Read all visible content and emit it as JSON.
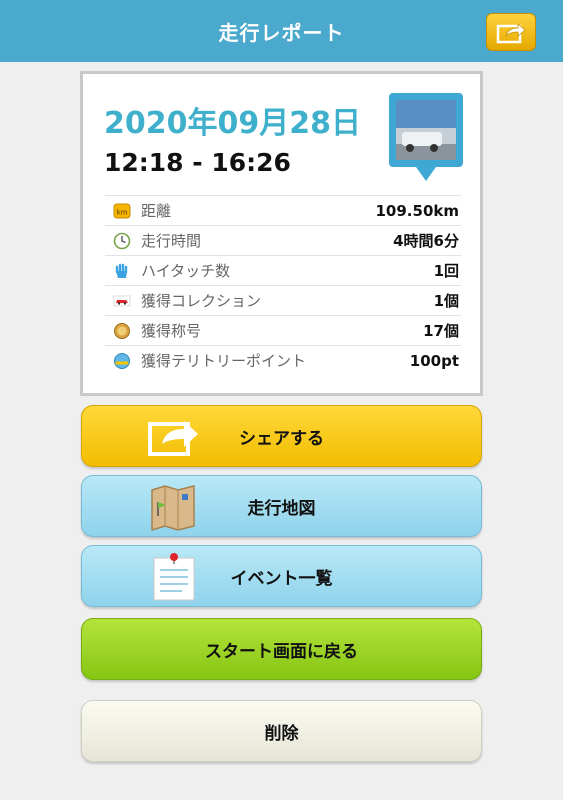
{
  "header": {
    "title": "走行レポート",
    "share_icon": "share-arrow-icon"
  },
  "report": {
    "date": "2020年09月28日",
    "time_range": "12:18 - 16:26",
    "stats": [
      {
        "icon": "km-badge-icon",
        "icon_text": "km",
        "label": "距離",
        "value": "109.50km"
      },
      {
        "icon": "clock-icon",
        "label": "走行時間",
        "value": "4時間6分"
      },
      {
        "icon": "high-five-hand-icon",
        "label": "ハイタッチ数",
        "value": "1回"
      },
      {
        "icon": "car-collection-icon",
        "label": "獲得コレクション",
        "value": "1個"
      },
      {
        "icon": "medal-icon",
        "label": "獲得称号",
        "value": "17個"
      },
      {
        "icon": "territory-point-icon",
        "label": "獲得テリトリーポイント",
        "value": "100pt"
      }
    ]
  },
  "buttons": {
    "share": "シェアする",
    "map": "走行地図",
    "events": "イベント一覧",
    "back_to_start": "スタート画面に戻る",
    "delete": "削除"
  },
  "colors": {
    "header": "#4aa9cc",
    "date": "#3fb0cc",
    "share_button": "#f2bd00",
    "map_button": "#8fd3ec",
    "start_button": "#86c513"
  }
}
